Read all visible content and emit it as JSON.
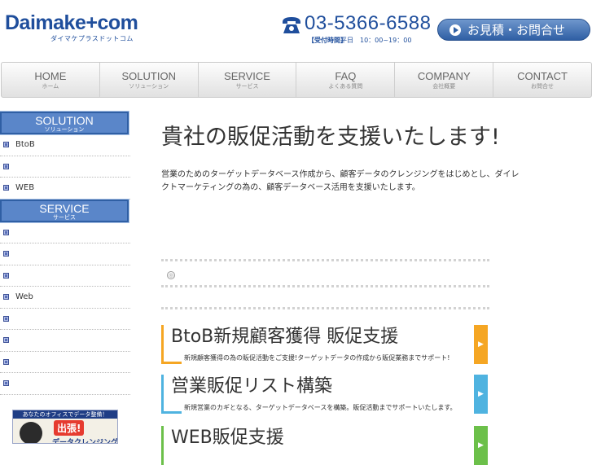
{
  "header": {
    "logo_text": "Daimake+com",
    "logo_sub": "ダイマケプラスドットコム",
    "phone_number": "03-5366-6588",
    "hours_label": "【受付時間】",
    "hours_value": "平日　10：00~19：00",
    "contact_button_label": "お見積・お問合せ"
  },
  "nav": {
    "items": [
      {
        "main": "HOME",
        "sub": "ホーム"
      },
      {
        "main": "SOLUTION",
        "sub": "ソリューション"
      },
      {
        "main": "SERVICE",
        "sub": "サービス"
      },
      {
        "main": "FAQ",
        "sub": "よくある質問"
      },
      {
        "main": "COMPANY",
        "sub": "会社概要"
      },
      {
        "main": "CONTACT",
        "sub": "お問合せ"
      }
    ]
  },
  "sidebar": {
    "solution_head": {
      "main": "SOLUTION",
      "sub": "ソリューション"
    },
    "solution_items": [
      "BtoB",
      "",
      "WEB"
    ],
    "service_head": {
      "main": "SERVICE",
      "sub": "サービス"
    },
    "service_items": [
      "",
      "",
      "",
      "Web",
      "",
      "",
      "",
      ""
    ],
    "banner": {
      "top_text": "あなたのオフィスでデータ整備！",
      "badge": "出張!",
      "sub": "データクレンジング"
    }
  },
  "main": {
    "title": "貴社の販促活動を支援いたします!",
    "intro": "営業のためのターゲットデータベース作成から、顧客データのクレンジングをはじめとし、ダイレクトマーケティングの為の、顧客データベース活用を支援いたします。",
    "news_icon": "◎",
    "services": [
      {
        "title": "BtoB新規顧客獲得 販促支援",
        "desc": "新規顧客獲得の為の販促活動をご支援!ターゲットデータの作成から販促業務までサポート!",
        "color": "#f5a623"
      },
      {
        "title": "営業販促リスト構築",
        "desc": "新規営業のカギとなる、ターゲットデータベースを構築。販促活動までサポートいたします。",
        "color": "#4fb3e0"
      },
      {
        "title": "WEB販促支援",
        "desc": "",
        "color": "#6cc04a"
      }
    ]
  },
  "colors": {
    "brand": "#1f4e9c",
    "sidebar_head": "#5a86c9"
  }
}
